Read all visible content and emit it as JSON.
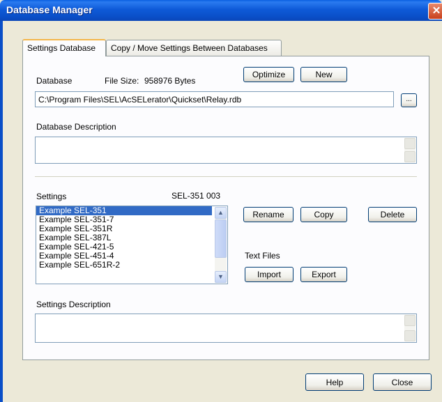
{
  "window": {
    "title": "Database Manager",
    "close_glyph": "✕"
  },
  "tabs": [
    {
      "label": "Settings Database",
      "active": true
    },
    {
      "label": "Copy / Move Settings Between Databases",
      "active": false
    }
  ],
  "database": {
    "label": "Database",
    "file_size_label": "File Size:",
    "file_size_value": "958976 Bytes",
    "optimize_label": "Optimize",
    "new_label": "New",
    "path": "C:\\Program Files\\SEL\\AcSELerator\\Quickset\\Relay.rdb",
    "browse_label": "...",
    "description_label": "Database Description",
    "description_value": ""
  },
  "settings": {
    "label": "Settings",
    "selected_name": "SEL-351 003",
    "items": [
      {
        "label": "Example SEL-351",
        "selected": true
      },
      {
        "label": "Example SEL-351-7",
        "selected": false
      },
      {
        "label": "Example SEL-351R",
        "selected": false
      },
      {
        "label": "Example SEL-387L",
        "selected": false
      },
      {
        "label": "Example SEL-421-5",
        "selected": false
      },
      {
        "label": "Example SEL-451-4",
        "selected": false
      },
      {
        "label": "Example SEL-651R-2",
        "selected": false
      }
    ],
    "rename_label": "Rename",
    "copy_label": "Copy",
    "delete_label": "Delete",
    "text_files_label": "Text Files",
    "import_label": "Import",
    "export_label": "Export",
    "description_label": "Settings Description",
    "description_value": ""
  },
  "footer": {
    "help_label": "Help",
    "close_label": "Close"
  },
  "colors": {
    "titlebar": "#0a4fc8",
    "selection": "#316ac5",
    "button_border": "#003c74",
    "tab_highlight": "#f4b64a"
  },
  "icons": {
    "scroll_up": "chevron-up-icon",
    "scroll_down": "chevron-down-icon",
    "close": "close-icon"
  }
}
